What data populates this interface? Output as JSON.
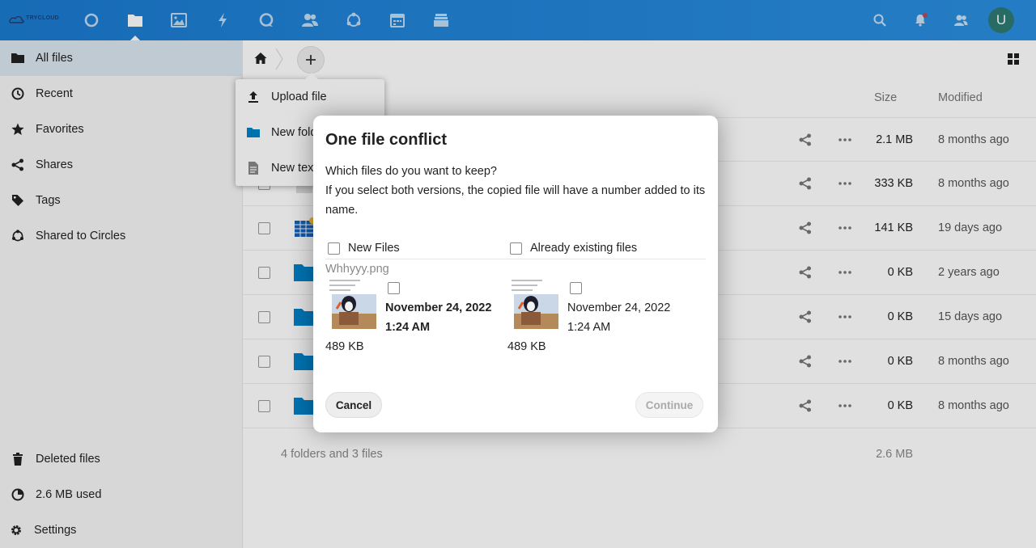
{
  "header": {
    "logo_text": "TRYCLOUD",
    "apps": [
      {
        "name": "dashboard-icon"
      },
      {
        "name": "files-icon"
      },
      {
        "name": "photos-icon"
      },
      {
        "name": "activity-icon"
      },
      {
        "name": "talk-icon"
      },
      {
        "name": "contacts-icon"
      },
      {
        "name": "circles-icon"
      },
      {
        "name": "calendar-icon"
      },
      {
        "name": "deck-icon"
      }
    ],
    "avatar_letter": "U",
    "colors": {
      "header_bg": "#1b7bd0",
      "avatar_bg": "#2d7a72",
      "notification_dot": "#e9322d"
    }
  },
  "sidebar": {
    "items": [
      {
        "label": "All files",
        "icon": "folder-icon"
      },
      {
        "label": "Recent",
        "icon": "clock-icon"
      },
      {
        "label": "Favorites",
        "icon": "star-icon"
      },
      {
        "label": "Shares",
        "icon": "share-icon"
      },
      {
        "label": "Tags",
        "icon": "tag-icon"
      },
      {
        "label": "Shared to Circles",
        "icon": "circles-icon"
      }
    ],
    "bottom": {
      "deleted": "Deleted files",
      "quota": "2.6 MB used",
      "settings": "Settings"
    }
  },
  "file_list": {
    "columns": {
      "size": "Size",
      "modified": "Modified"
    },
    "rows": [
      {
        "size": "2.1 MB",
        "modified": "8 months ago",
        "type": "file-image"
      },
      {
        "size": "333 KB",
        "modified": "8 months ago",
        "type": "file-generic"
      },
      {
        "size": "141 KB",
        "modified": "19 days ago",
        "type": "file-spreadsheet"
      },
      {
        "size": "0 KB",
        "modified": "2 years ago",
        "type": "folder"
      },
      {
        "size": "0 KB",
        "modified": "15 days ago",
        "type": "folder"
      },
      {
        "size": "0 KB",
        "modified": "8 months ago",
        "type": "folder"
      },
      {
        "size": "0 KB",
        "modified": "8 months ago",
        "type": "folder"
      }
    ],
    "summary": "4 folders and 3 files",
    "summary_size": "2.6 MB"
  },
  "new_menu": {
    "items": [
      {
        "label": "Upload file",
        "icon": "upload-icon"
      },
      {
        "label": "New folder",
        "icon": "folder-icon"
      },
      {
        "label": "New text file",
        "icon": "text-file-icon"
      }
    ]
  },
  "conflict_dialog": {
    "title": "One file conflict",
    "question": "Which files do you want to keep?",
    "explanation": "If you select both versions, the copied file will have a number added to its name.",
    "new_files_label": "New Files",
    "existing_files_label": "Already existing files",
    "filename": "Whhyyy.png",
    "new_file": {
      "date": "November 24, 2022",
      "time": "1:24 AM",
      "size": "489 KB"
    },
    "existing_file": {
      "date": "November 24, 2022",
      "time": "1:24 AM",
      "size": "489 KB"
    },
    "cancel_label": "Cancel",
    "continue_label": "Continue"
  }
}
